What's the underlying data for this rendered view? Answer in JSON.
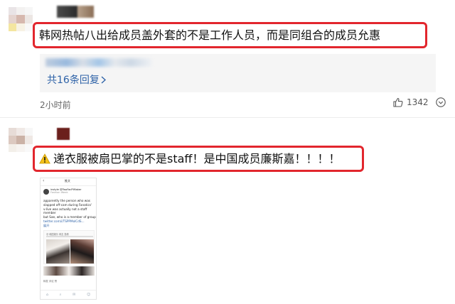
{
  "comments": [
    {
      "avatar_colors": [
        "#e9e4e6",
        "#f3f1f0",
        "#f6f6f6",
        "#e5d4cf",
        "#d6b8ae",
        "#ece6e3",
        "#f4e6a0",
        "#f7f2e4",
        "#f8f8f8"
      ],
      "text": "韩网热帖八出给成员盖外套的不是工作人员，而是同组合的成员允惠",
      "replies_link": "共16条回复",
      "time": "2小时前",
      "likes": "1342"
    },
    {
      "avatar_colors": [
        "#e7dcd7",
        "#f0e9e6",
        "#f7f7f7",
        "#dcc9c0",
        "#cbb2a6",
        "#efe8e4",
        "#f3efe9",
        "#f7f4f1",
        "#f9f9f9"
      ],
      "text": "递衣服被扇巴掌的不是staff！是中国成员廉斯嘉！！！！"
    }
  ],
  "embedded_screenshot": {
    "header_back": "‹",
    "header_title": "推文",
    "user_name": "instyle @TwoFacPIMaker",
    "user_sub": "Fashion Week",
    "body_lines": [
      "apparently the person who was",
      "slapped off-cam during Fanatics'",
      "v-live was actually not a staff member",
      "but Sae, who is a member of group",
      "twitter.com/i/TSPPMolCdS..."
    ],
    "show_more": "展开",
    "card_source": "@ 韩国娱乐 网友 投稿",
    "actions": "转发   评论   赞"
  },
  "colors": {
    "highlight_border": "#e2262d",
    "link": "#2f63a8",
    "muted": "#666666",
    "panel_bg": "#f5f5f5"
  },
  "icons": [
    "thumbs-up-icon",
    "more-icon",
    "warning-icon",
    "chevron-right-icon"
  ]
}
